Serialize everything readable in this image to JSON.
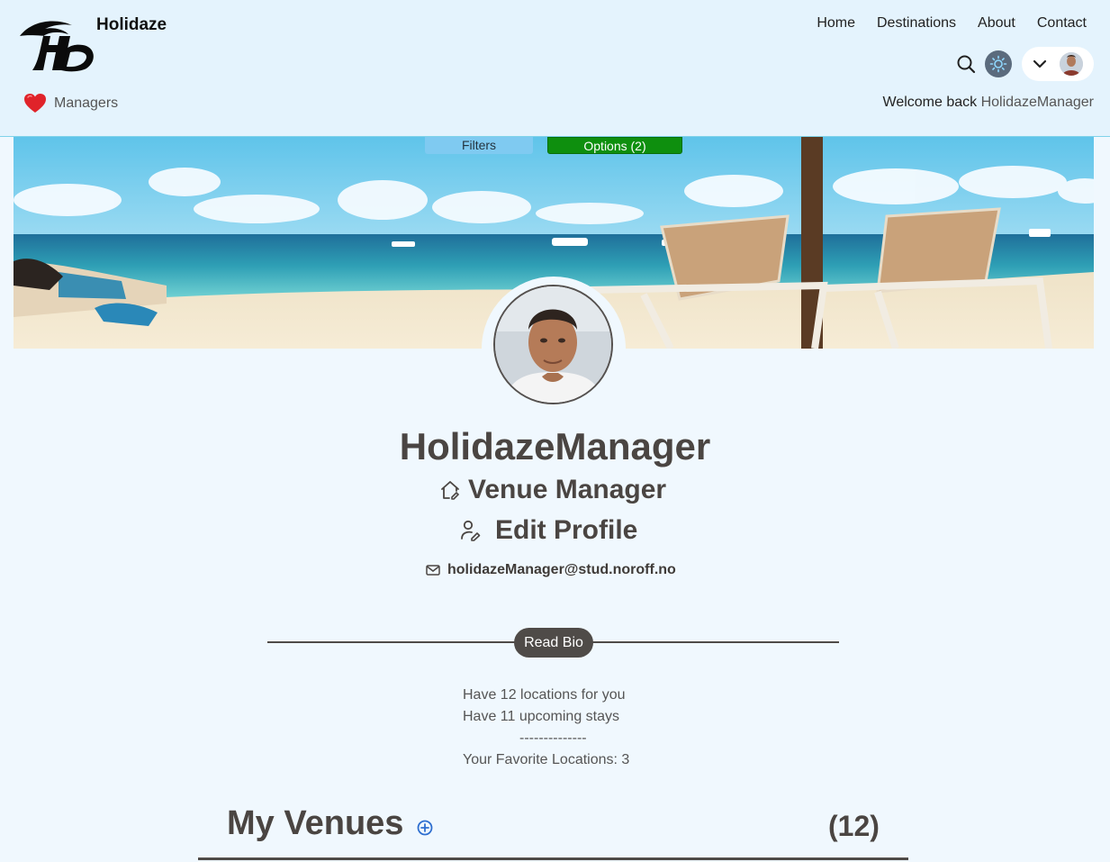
{
  "header": {
    "brand": "Holidaze",
    "nav": [
      "Home",
      "Destinations",
      "About",
      "Contact"
    ],
    "managers_label": "Managers",
    "welcome_prefix": "Welcome back",
    "welcome_user": "HolidazeManager"
  },
  "banner_tabs": {
    "filters": "Filters",
    "options": "Options (2)"
  },
  "profile": {
    "username": "HolidazeManager",
    "role": "Venue Manager",
    "edit_label": "Edit Profile",
    "email": "holidazeManager@stud.noroff.no",
    "read_bio": "Read Bio",
    "stats": {
      "locations": "Have 12 locations for you",
      "stays": "Have 11 upcoming stays",
      "separator": "--------------",
      "favorites": "Your Favorite Locations: 3"
    }
  },
  "venues": {
    "title": "My Venues",
    "count": "(12)"
  },
  "colors": {
    "header_bg": "#e4f3fd",
    "page_bg": "#f0f8fe",
    "options_green": "#0e8f0e",
    "filters_blue": "#7fcaf1",
    "text_dark": "#4a4542"
  },
  "icons": [
    "logo",
    "heart-icon",
    "search-icon",
    "sun-icon",
    "chevron-down-icon",
    "home-icon",
    "user-edit-icon",
    "mail-icon",
    "plus-circle-icon"
  ]
}
